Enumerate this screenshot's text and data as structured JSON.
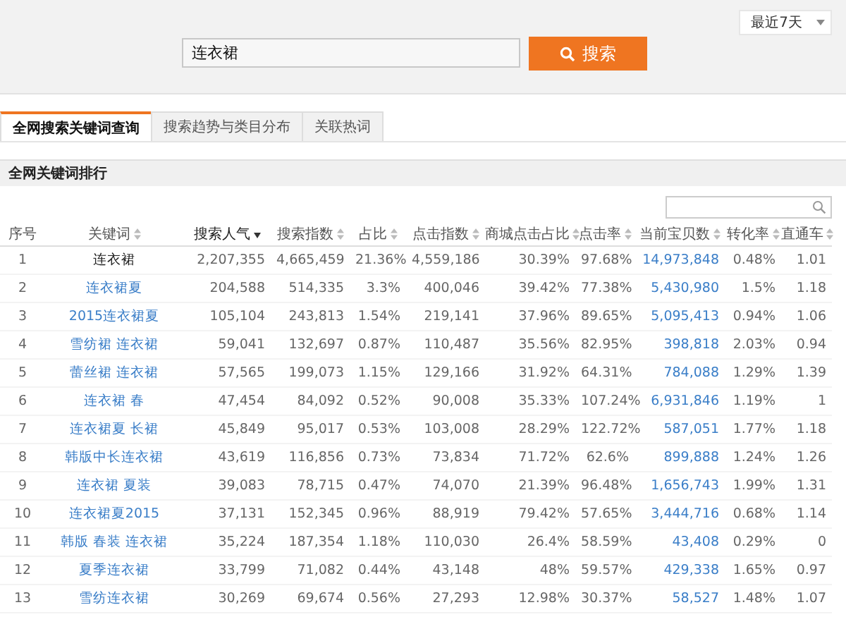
{
  "period_dropdown": {
    "value": "最近7天"
  },
  "search": {
    "value": "连衣裙",
    "button": "搜索"
  },
  "tabs": [
    {
      "label": "全网搜索关键词查询",
      "selected": true
    },
    {
      "label": "搜索趋势与类目分布",
      "selected": false
    },
    {
      "label": "关联热词",
      "selected": false
    }
  ],
  "section_title": "全网关键词排行",
  "table": {
    "columns": [
      {
        "label": "序号",
        "sortable": false,
        "sorted": false
      },
      {
        "label": "关键词",
        "sortable": true,
        "sorted": false
      },
      {
        "label": "搜索人气",
        "sortable": true,
        "sorted": true
      },
      {
        "label": "搜索指数",
        "sortable": true,
        "sorted": false
      },
      {
        "label": "占比",
        "sortable": true,
        "sorted": false
      },
      {
        "label": "点击指数",
        "sortable": true,
        "sorted": false
      },
      {
        "label": "商城点击占比",
        "sortable": true,
        "sorted": false
      },
      {
        "label": "点击率",
        "sortable": true,
        "sorted": false
      },
      {
        "label": "当前宝贝数",
        "sortable": true,
        "sorted": false
      },
      {
        "label": "转化率",
        "sortable": true,
        "sorted": false
      },
      {
        "label": "直通车",
        "sortable": true,
        "sorted": false
      }
    ],
    "rows": [
      {
        "current": true,
        "cells": [
          "1",
          "连衣裙",
          "2,207,355",
          "4,665,459",
          "21.36%",
          "4,559,186",
          "30.39%",
          "97.68%",
          "14,973,848",
          "0.48%",
          "1.01"
        ]
      },
      {
        "current": false,
        "cells": [
          "2",
          "连衣裙夏",
          "204,588",
          "514,335",
          "3.3%",
          "400,046",
          "39.42%",
          "77.38%",
          "5,430,980",
          "1.5%",
          "1.18"
        ]
      },
      {
        "current": false,
        "cells": [
          "3",
          "2015连衣裙夏",
          "105,104",
          "243,813",
          "1.54%",
          "219,141",
          "37.96%",
          "89.65%",
          "5,095,413",
          "0.94%",
          "1.06"
        ]
      },
      {
        "current": false,
        "cells": [
          "4",
          "雪纺裙 连衣裙",
          "59,041",
          "132,697",
          "0.87%",
          "110,487",
          "35.56%",
          "82.95%",
          "398,818",
          "2.03%",
          "0.94"
        ]
      },
      {
        "current": false,
        "cells": [
          "5",
          "蕾丝裙 连衣裙",
          "57,565",
          "199,073",
          "1.15%",
          "129,166",
          "31.92%",
          "64.31%",
          "784,088",
          "1.29%",
          "1.39"
        ]
      },
      {
        "current": false,
        "cells": [
          "6",
          "连衣裙 春",
          "47,454",
          "84,092",
          "0.52%",
          "90,008",
          "35.33%",
          "107.24%",
          "6,931,846",
          "1.19%",
          "1"
        ]
      },
      {
        "current": false,
        "cells": [
          "7",
          "连衣裙夏 长裙",
          "45,849",
          "95,017",
          "0.53%",
          "103,008",
          "28.29%",
          "122.72%",
          "587,051",
          "1.77%",
          "1.18"
        ]
      },
      {
        "current": false,
        "cells": [
          "8",
          "韩版中长连衣裙",
          "43,619",
          "116,856",
          "0.73%",
          "73,834",
          "71.72%",
          "62.6%",
          "899,888",
          "1.24%",
          "1.26"
        ]
      },
      {
        "current": false,
        "cells": [
          "9",
          "连衣裙 夏装",
          "39,083",
          "78,715",
          "0.47%",
          "74,070",
          "21.39%",
          "96.48%",
          "1,656,743",
          "1.99%",
          "1.31"
        ]
      },
      {
        "current": false,
        "cells": [
          "10",
          "连衣裙夏2015",
          "37,131",
          "152,345",
          "0.96%",
          "88,919",
          "79.42%",
          "57.65%",
          "3,444,716",
          "0.68%",
          "1.14"
        ]
      },
      {
        "current": false,
        "cells": [
          "11",
          "韩版 春装 连衣裙",
          "35,224",
          "187,354",
          "1.18%",
          "110,030",
          "26.4%",
          "58.59%",
          "43,408",
          "0.29%",
          "0"
        ]
      },
      {
        "current": false,
        "cells": [
          "12",
          "夏季连衣裙",
          "33,799",
          "71,082",
          "0.44%",
          "43,148",
          "48%",
          "59.57%",
          "429,338",
          "1.65%",
          "0.97"
        ]
      },
      {
        "current": false,
        "cells": [
          "13",
          "雪纺连衣裙",
          "30,269",
          "69,674",
          "0.56%",
          "27,293",
          "12.98%",
          "30.37%",
          "58,527",
          "1.48%",
          "1.07"
        ]
      }
    ]
  }
}
